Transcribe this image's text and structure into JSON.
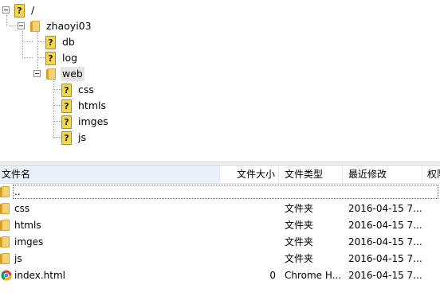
{
  "tree": {
    "root": {
      "label": "/"
    },
    "user_folder": {
      "label": "zhaoyi03"
    },
    "children": [
      {
        "label": "db"
      },
      {
        "label": "log"
      },
      {
        "label": "web"
      }
    ],
    "web_children": [
      {
        "label": "css"
      },
      {
        "label": "htmls"
      },
      {
        "label": "imges"
      },
      {
        "label": "js"
      }
    ]
  },
  "list": {
    "columns": {
      "name": "文件名",
      "size": "文件大小",
      "type": "文件类型",
      "modified": "最近修改",
      "perms": "权限"
    },
    "sort_indicator": "^",
    "rows": [
      {
        "name": "..",
        "size": "",
        "type": "",
        "modified": ""
      },
      {
        "name": "css",
        "size": "",
        "type": "文件夹",
        "modified": "2016-04-15 7..."
      },
      {
        "name": "htmls",
        "size": "",
        "type": "文件夹",
        "modified": "2016-04-15 7..."
      },
      {
        "name": "imges",
        "size": "",
        "type": "文件夹",
        "modified": "2016-04-15 7..."
      },
      {
        "name": "js",
        "size": "",
        "type": "文件夹",
        "modified": "2016-04-15 7..."
      },
      {
        "name": "index.html",
        "size": "0",
        "type": "Chrome H...",
        "modified": "2016-04-15 7..."
      }
    ]
  },
  "icons": {
    "unknown": "question-mark-icon",
    "folder": "folder-icon",
    "browser_file": "chrome-icon"
  },
  "colors": {
    "folder": "#f7d275",
    "unknown_icon": "#f4d54e",
    "sorted_column": "#e8f0f9"
  }
}
